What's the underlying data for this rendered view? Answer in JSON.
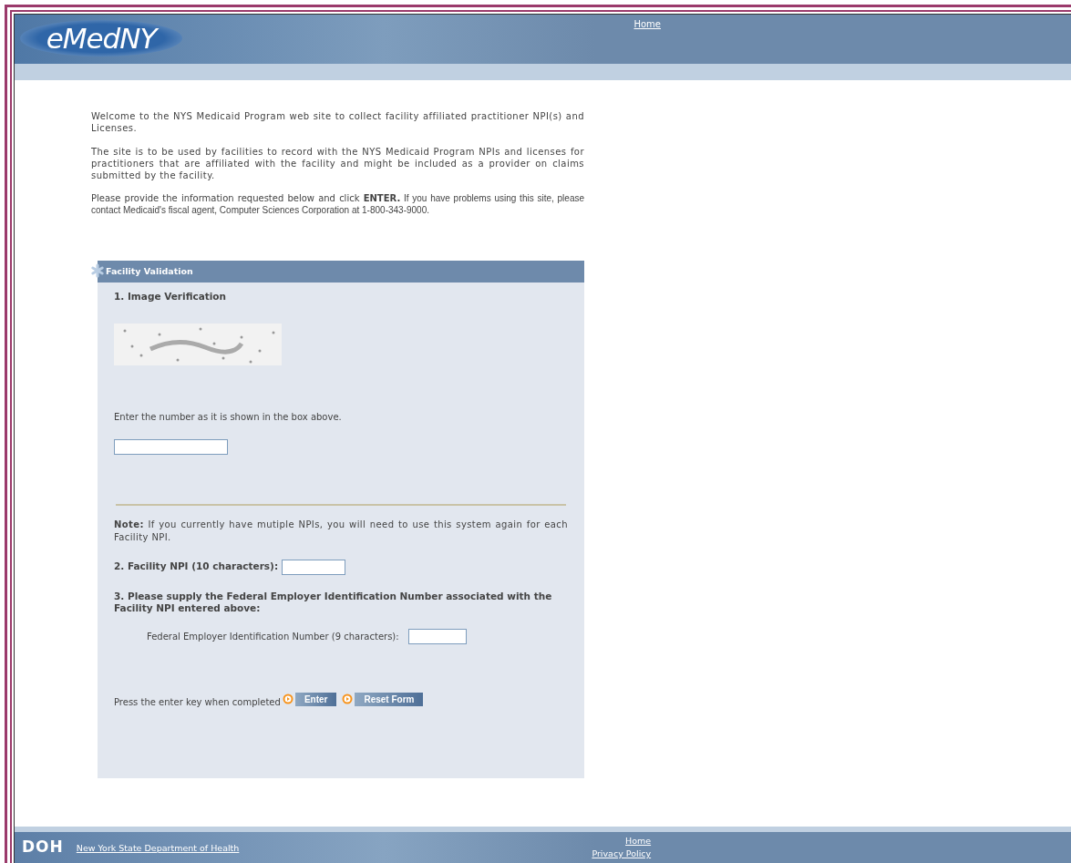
{
  "header": {
    "logo": "eMedNY",
    "links": [
      "Home"
    ]
  },
  "intro": [
    "Welcome to the NYS Medicaid Program web site to collect facility affiliated practitioner NPI(s) and Licenses.",
    "The site is to be used by facilities to record with the NYS Medicaid Program NPIs and licenses for practitioners that are affiliated with the facility and might be included as a provider on claims submitted by the facility."
  ],
  "instruction": {
    "lead": "Please provide the information requested below and click **ENTER.**",
    "rest": "If you have problems using this site, please contact Medicaid's fiscal agent, Computer Sciences Corporation at 1-800-343-9000."
  },
  "form": {
    "title": "Facility Validation",
    "step1": {
      "heading": "1. Image Verification",
      "prompt": "Enter the number as it is shown in the box above."
    },
    "note": "**Note:** If you currently have mutiple NPIs, you will need to use this system again for each Facility NPI.",
    "step2": {
      "label": "2. Facility NPI (10 characters):"
    },
    "step3": {
      "heading": "3. Please supply the Federal Employer Identification Number associated with the Facility NPI entered above:",
      "label": "Federal Employer Identification Number (9 characters):"
    },
    "submit_hint": "Press the enter key when completed",
    "buttons": [
      "Enter",
      "Reset Form"
    ]
  },
  "footer": {
    "logo": "DOH",
    "org_link": "New York State Department of Health",
    "links": [
      "Home",
      "Privacy Policy"
    ]
  }
}
